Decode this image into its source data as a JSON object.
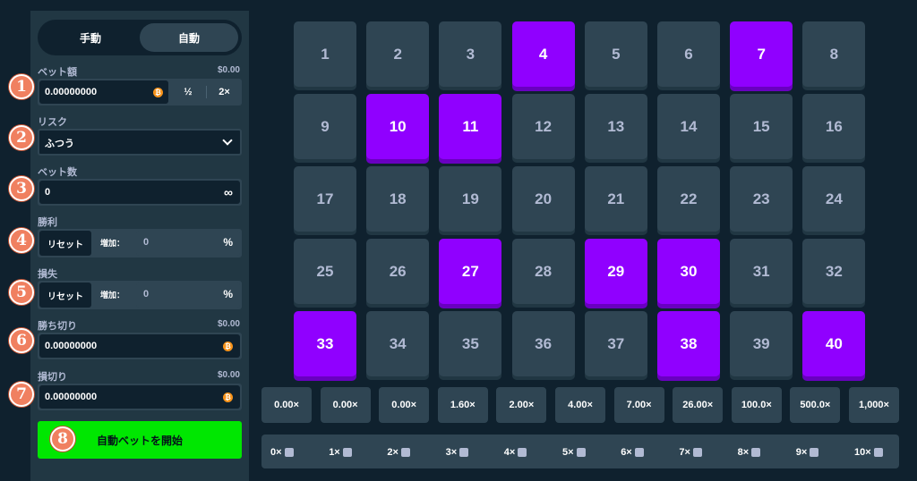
{
  "mode": {
    "manual": "手動",
    "auto": "自動"
  },
  "bet_amount": {
    "label": "ベット額",
    "usd": "$0.00",
    "value": "0.00000000",
    "half": "½",
    "double": "2×"
  },
  "risk": {
    "label": "リスク",
    "value": "ふつう"
  },
  "bet_count": {
    "label": "ベット数",
    "value": "0",
    "infinity": "∞"
  },
  "win": {
    "label": "勝利",
    "reset": "リセット",
    "increase": "増加：",
    "value": "0",
    "pct": "%"
  },
  "loss": {
    "label": "損失",
    "reset": "リセット",
    "increase": "増加：",
    "value": "0",
    "pct": "%"
  },
  "stop_profit": {
    "label": "勝ち切り",
    "usd": "$0.00",
    "value": "0.00000000"
  },
  "stop_loss": {
    "label": "損切り",
    "usd": "$0.00",
    "value": "0.00000000"
  },
  "start_button": "自動ベットを開始",
  "badges": [
    "1",
    "2",
    "3",
    "4",
    "5",
    "6",
    "7",
    "8"
  ],
  "tiles": [
    "1",
    "2",
    "3",
    "4",
    "5",
    "6",
    "7",
    "8",
    "9",
    "10",
    "11",
    "12",
    "13",
    "14",
    "15",
    "16",
    "17",
    "18",
    "19",
    "20",
    "21",
    "22",
    "23",
    "24",
    "25",
    "26",
    "27",
    "28",
    "29",
    "30",
    "31",
    "32",
    "33",
    "34",
    "35",
    "36",
    "37",
    "38",
    "39",
    "40"
  ],
  "selected": [
    4,
    7,
    10,
    11,
    27,
    29,
    30,
    33,
    38,
    40
  ],
  "multipliers": [
    "0.00×",
    "0.00×",
    "0.00×",
    "1.60×",
    "2.00×",
    "4.00×",
    "7.00×",
    "26.00×",
    "100.0×",
    "500.0×",
    "1,000×"
  ],
  "hits": [
    "0×",
    "1×",
    "2×",
    "3×",
    "4×",
    "5×",
    "6×",
    "7×",
    "8×",
    "9×",
    "10×"
  ],
  "colors": {
    "selected": "#9000ff",
    "tile": "#2f4553",
    "start": "#00e701",
    "coin": "#f7931a"
  }
}
